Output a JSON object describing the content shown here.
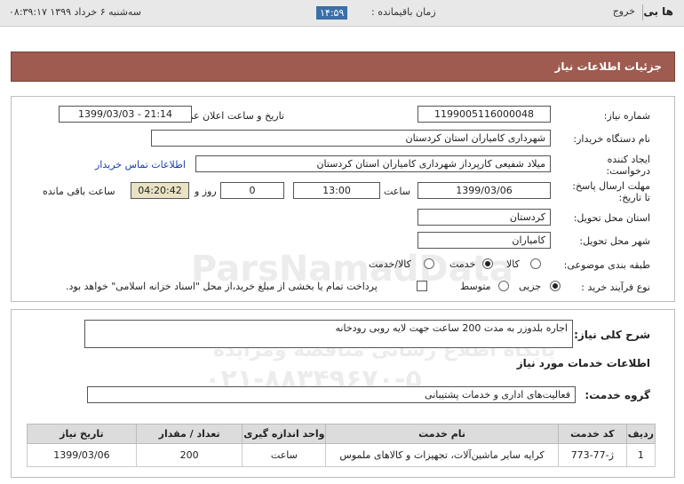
{
  "topbar": {
    "logo": "ها بی",
    "logout": "خروج",
    "remaining_label": "زمان باقیمانده :",
    "remaining_time": "۱۴:۵۹",
    "datetime": "سه‌شنبه ۶ خرداد ۱۳۹۹    ۰۸:۳۹:۱۷"
  },
  "header": {
    "title": "جزئیات اطلاعات نیاز"
  },
  "form": {
    "need_number_label": "شماره نیاز:",
    "need_number": "1199005116000048",
    "announce_label": "تاریخ و ساعت اعلان عمومی:",
    "announce_value": "1399/03/03 - 21:14",
    "buyer_label": "نام دستگاه خریدار:",
    "buyer_value": "شهرداری کامیاران استان کردستان",
    "creator_label_1": "ایجاد کننده",
    "creator_label_2": "درخواست:",
    "creator_value": "میلاد شفیعی کارپرداز شهرداری کامیاران استان کردستان",
    "contact_link": "اطلاعات تماس خریدار",
    "deadline_label_1": "مهلت ارسال پاسخ:",
    "deadline_label_2": "تا تاریخ:",
    "deadline_date": "1399/03/06",
    "hour_label": "ساعت",
    "deadline_hour": "13:00",
    "days_value": "0",
    "days_label": "روز و",
    "remaining_value": "04:20:42",
    "remaining_label": "ساعت باقی مانده",
    "province_label": "استان محل تحویل:",
    "province_value": "کردستان",
    "city_label": "شهر محل تحویل:",
    "city_value": "کامیاران",
    "category_label": "طبقه بندی موضوعی:",
    "category_options": [
      "کالا",
      "خدمت",
      "کالا/خدمت"
    ],
    "process_label": "نوع فرآیند خرید :",
    "process_options": [
      "جزیی",
      "متوسط"
    ],
    "payment_note": "پرداخت تمام یا بخشی از مبلغ خرید،از محل \"اسناد خزانه اسلامی\" خواهد بود."
  },
  "details": {
    "description_label": "شرح کلی نیاز:",
    "description_value": "اجاره بلدوزر به مدت 200 ساعت جهت لایه روبی رودخانه",
    "services_title": "اطلاعات خدمات مورد نیاز",
    "group_label": "گروه خدمت:",
    "group_value": "فعالیت‌های اداری و خدمات پشتیبانی",
    "table_headers": [
      "ردیف",
      "کد خدمت",
      "نام خدمت",
      "واحد اندازه گیری",
      "تعداد / مقدار",
      "تاریخ نیاز"
    ],
    "table_rows": [
      [
        "1",
        "ژ-77-773",
        "کرایه سایر ماشین‌آلات، تجهیزات و کالاهای ملموس",
        "ساعت",
        "200",
        "1399/03/06"
      ]
    ]
  },
  "watermark": {
    "line1": "ParsNamadData",
    "line2": "پایگاه اطلاع رسانی مناقصه ومزایده",
    "line3": "۰۲۱-۸۸۳۴۹۶۷۰-۵"
  }
}
